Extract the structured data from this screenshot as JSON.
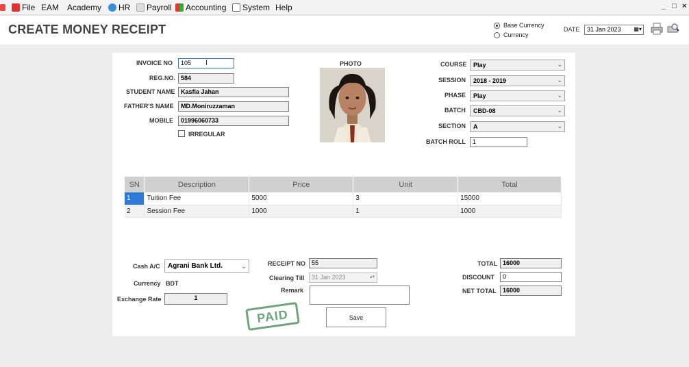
{
  "menu": {
    "items": [
      {
        "label": "File",
        "icon": "file-icon"
      },
      {
        "label": "EAM",
        "icon": ""
      },
      {
        "label": "Academy",
        "icon": ""
      },
      {
        "label": "HR",
        "icon": "hr-icon"
      },
      {
        "label": "Payroll",
        "icon": "payroll-icon"
      },
      {
        "label": "Accounting",
        "icon": "accounting-icon"
      },
      {
        "label": "System",
        "icon": "system-icon"
      },
      {
        "label": "Help",
        "icon": ""
      }
    ],
    "window_controls": [
      "_",
      "□",
      "×"
    ]
  },
  "header": {
    "title": "CREATE MONEY RECEIPT",
    "radio_base": "Base Currency",
    "radio_currency": "Currency",
    "date_label": "DATE",
    "date_value": "31 Jan 2023"
  },
  "student": {
    "invoice_label": "INVOICE NO",
    "invoice_value": "105",
    "regno_label": "REG.NO.",
    "regno_value": "584",
    "name_label": "STUDENT NAME",
    "name_value": "Kasfia Jahan",
    "father_label": "FATHER'S NAME",
    "father_value": "MD.Moniruzzaman",
    "mobile_label": "MOBILE",
    "mobile_value": "01996060733",
    "irregular_label": "IRREGULAR",
    "photo_label": "PHOTO"
  },
  "academic": {
    "course_label": "COURSE",
    "course_value": "Play",
    "session_label": "SESSION",
    "session_value": "2018 - 2019",
    "phase_label": "PHASE",
    "phase_value": "Play",
    "batch_label": "BATCH",
    "batch_value": "CBD-08",
    "section_label": "SECTION",
    "section_value": "A",
    "batch_roll_label": "BATCH ROLL",
    "batch_roll_value": "1"
  },
  "table": {
    "columns": [
      "SN",
      "Description",
      "Price",
      "Unit",
      "Total"
    ],
    "rows": [
      [
        "1",
        "Tuition Fee",
        "5000",
        "3",
        "15000"
      ],
      [
        "2",
        "Session Fee",
        "1000",
        "1",
        "1000"
      ]
    ]
  },
  "payment": {
    "cash_label": "Cash A/C",
    "cash_value": "Agrani Bank Ltd.",
    "currency_label": "Currency",
    "currency_value": "BDT",
    "exchange_label": "Exchange Rate",
    "exchange_value": "1",
    "receipt_label": "RECEIPT NO",
    "receipt_value": "55",
    "clearing_label": "Clearing Till",
    "clearing_value": "31 Jan 2023",
    "remark_label": "Remark",
    "remark_value": "",
    "save_label": "Save",
    "paid_stamp": "PAID"
  },
  "totals": {
    "total_label": "TOTAL",
    "total_value": "16000",
    "discount_label": "DISCOUNT",
    "discount_value": "0",
    "net_label": "NET TOTAL",
    "net_value": "16000"
  },
  "colors": {
    "selected_cell": "#2e7ad6",
    "stamp_green": "#6fa37c",
    "header_gray": "#d0d0d0"
  }
}
